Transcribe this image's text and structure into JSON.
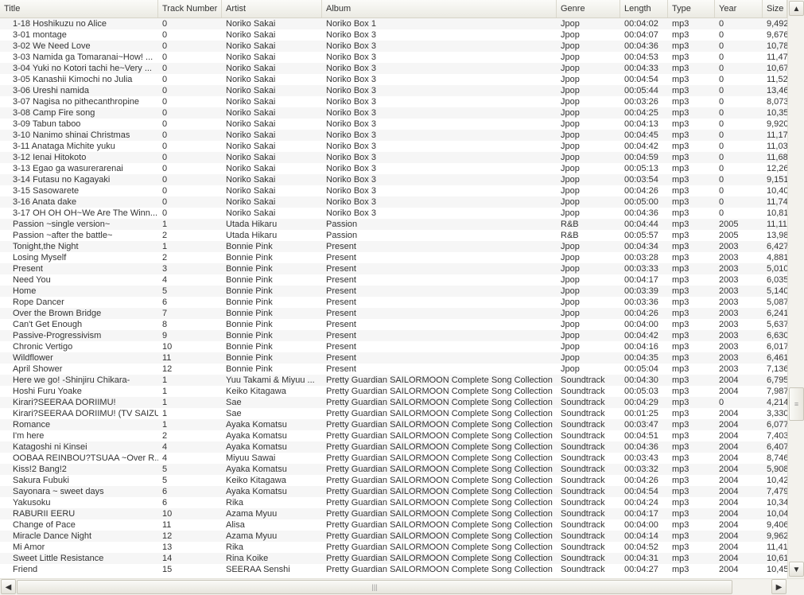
{
  "columns": [
    "Title",
    "Track Number",
    "Artist",
    "Album",
    "Genre",
    "Length",
    "Type",
    "Year",
    "Size"
  ],
  "rows": [
    [
      "1-18 Hoshikuzu no Alice",
      "0",
      "Noriko Sakai",
      "Noriko Box 1",
      "Jpop",
      "00:04:02",
      "mp3",
      "0",
      "9,492"
    ],
    [
      "3-01 montage",
      "0",
      "Noriko Sakai",
      "Noriko Box 3",
      "Jpop",
      "00:04:07",
      "mp3",
      "0",
      "9,676"
    ],
    [
      "3-02 We Need Love",
      "0",
      "Noriko Sakai",
      "Noriko Box 3",
      "Jpop",
      "00:04:36",
      "mp3",
      "0",
      "10,78"
    ],
    [
      "3-03 Namida ga Tomaranai~How! ...",
      "0",
      "Noriko Sakai",
      "Noriko Box 3",
      "Jpop",
      "00:04:53",
      "mp3",
      "0",
      "11,47"
    ],
    [
      "3-04 Yuki no Kotori tachi he~Very ...",
      "0",
      "Noriko Sakai",
      "Noriko Box 3",
      "Jpop",
      "00:04:33",
      "mp3",
      "0",
      "10,67"
    ],
    [
      "3-05 Kanashii Kimochi no Julia",
      "0",
      "Noriko Sakai",
      "Noriko Box 3",
      "Jpop",
      "00:04:54",
      "mp3",
      "0",
      "11,52"
    ],
    [
      "3-06 Ureshi namida",
      "0",
      "Noriko Sakai",
      "Noriko Box 3",
      "Jpop",
      "00:05:44",
      "mp3",
      "0",
      "13,46"
    ],
    [
      "3-07 Nagisa no pithecanthropine",
      "0",
      "Noriko Sakai",
      "Noriko Box 3",
      "Jpop",
      "00:03:26",
      "mp3",
      "0",
      "8,073"
    ],
    [
      "3-08 Camp Fire song",
      "0",
      "Noriko Sakai",
      "Noriko Box 3",
      "Jpop",
      "00:04:25",
      "mp3",
      "0",
      "10,35"
    ],
    [
      "3-09 Tabun taboo",
      "0",
      "Noriko Sakai",
      "Noriko Box 3",
      "Jpop",
      "00:04:13",
      "mp3",
      "0",
      "9,920"
    ],
    [
      "3-10 Nanimo shinai Christmas",
      "0",
      "Noriko Sakai",
      "Noriko Box 3",
      "Jpop",
      "00:04:45",
      "mp3",
      "0",
      "11,17"
    ],
    [
      "3-11 Anataga Michite yuku",
      "0",
      "Noriko Sakai",
      "Noriko Box 3",
      "Jpop",
      "00:04:42",
      "mp3",
      "0",
      "11,03"
    ],
    [
      "3-12 Ienai Hitokoto",
      "0",
      "Noriko Sakai",
      "Noriko Box 3",
      "Jpop",
      "00:04:59",
      "mp3",
      "0",
      "11,68"
    ],
    [
      "3-13 Egao ga wasurerarenai",
      "0",
      "Noriko Sakai",
      "Noriko Box 3",
      "Jpop",
      "00:05:13",
      "mp3",
      "0",
      "12,26"
    ],
    [
      "3-14 Futasu no Kagayaki",
      "0",
      "Noriko Sakai",
      "Noriko Box 3",
      "Jpop",
      "00:03:54",
      "mp3",
      "0",
      "9,151"
    ],
    [
      "3-15 Sasowarete",
      "0",
      "Noriko Sakai",
      "Noriko Box 3",
      "Jpop",
      "00:04:26",
      "mp3",
      "0",
      "10,40"
    ],
    [
      "3-16 Anata dake",
      "0",
      "Noriko Sakai",
      "Noriko Box 3",
      "Jpop",
      "00:05:00",
      "mp3",
      "0",
      "11,74"
    ],
    [
      "3-17 OH OH OH~We Are The Winn...",
      "0",
      "Noriko Sakai",
      "Noriko Box 3",
      "Jpop",
      "00:04:36",
      "mp3",
      "0",
      "10,81"
    ],
    [
      "Passion ~single version~",
      "1",
      "Utada Hikaru",
      "Passion",
      "R&B",
      "00:04:44",
      "mp3",
      "2005",
      "11,11"
    ],
    [
      "Passion ~after the battle~",
      "2",
      "Utada Hikaru",
      "Passion",
      "R&B",
      "00:05:57",
      "mp3",
      "2005",
      "13,98"
    ],
    [
      "Tonight,the Night",
      "1",
      "Bonnie Pink",
      "Present",
      "Jpop",
      "00:04:34",
      "mp3",
      "2003",
      "6,427"
    ],
    [
      "Losing Myself",
      "2",
      "Bonnie Pink",
      "Present",
      "Jpop",
      "00:03:28",
      "mp3",
      "2003",
      "4,881"
    ],
    [
      "Present",
      "3",
      "Bonnie Pink",
      "Present",
      "Jpop",
      "00:03:33",
      "mp3",
      "2003",
      "5,010"
    ],
    [
      "Need You",
      "4",
      "Bonnie Pink",
      "Present",
      "Jpop",
      "00:04:17",
      "mp3",
      "2003",
      "6,035"
    ],
    [
      "Home",
      "5",
      "Bonnie Pink",
      "Present",
      "Jpop",
      "00:03:39",
      "mp3",
      "2003",
      "5,140"
    ],
    [
      "Rope Dancer",
      "6",
      "Bonnie Pink",
      "Present",
      "Jpop",
      "00:03:36",
      "mp3",
      "2003",
      "5,087"
    ],
    [
      "Over the Brown Bridge",
      "7",
      "Bonnie Pink",
      "Present",
      "Jpop",
      "00:04:26",
      "mp3",
      "2003",
      "6,241"
    ],
    [
      "Can't Get Enough",
      "8",
      "Bonnie Pink",
      "Present",
      "Jpop",
      "00:04:00",
      "mp3",
      "2003",
      "5,637"
    ],
    [
      "Passive-Progressivism",
      "9",
      "Bonnie Pink",
      "Present",
      "Jpop",
      "00:04:42",
      "mp3",
      "2003",
      "6,630"
    ],
    [
      "Chronic Vertigo",
      "10",
      "Bonnie Pink",
      "Present",
      "Jpop",
      "00:04:16",
      "mp3",
      "2003",
      "6,017"
    ],
    [
      "Wildflower",
      "11",
      "Bonnie Pink",
      "Present",
      "Jpop",
      "00:04:35",
      "mp3",
      "2003",
      "6,461"
    ],
    [
      "April Shower",
      "12",
      "Bonnie Pink",
      "Present",
      "Jpop",
      "00:05:04",
      "mp3",
      "2003",
      "7,136"
    ],
    [
      "Here we go! -Shinjiru Chikara-",
      "1",
      "Yuu Takami & Miyuu ...",
      "Pretty Guardian SAILORMOON Complete Song Collection",
      "Soundtrack",
      "00:04:30",
      "mp3",
      "2004",
      "6,795"
    ],
    [
      "Hoshi Furu Yoake",
      "1",
      "Keiko Kitagawa",
      "Pretty Guardian SAILORMOON Complete Song Collection",
      "Soundtrack",
      "00:05:03",
      "mp3",
      "2004",
      "7,987"
    ],
    [
      "Kirari?SEERAA DORIIMU!",
      "1",
      "Sae",
      "Pretty Guardian SAILORMOON Complete Song Collection",
      "Soundtrack",
      "00:04:29",
      "mp3",
      "0",
      "4,214"
    ],
    [
      "Kirari?SEERAA DORIIMU! (TV SAIZU)",
      "1",
      "Sae",
      "Pretty Guardian SAILORMOON Complete Song Collection",
      "Soundtrack",
      "00:01:25",
      "mp3",
      "2004",
      "3,330"
    ],
    [
      "Romance",
      "1",
      "Ayaka Komatsu",
      "Pretty Guardian SAILORMOON Complete Song Collection",
      "Soundtrack",
      "00:03:47",
      "mp3",
      "2004",
      "6,077"
    ],
    [
      "I'm here",
      "2",
      "Ayaka Komatsu",
      "Pretty Guardian SAILORMOON Complete Song Collection",
      "Soundtrack",
      "00:04:51",
      "mp3",
      "2004",
      "7,403"
    ],
    [
      "Katagoshi ni Kinsei",
      "4",
      "Ayaka Komatsu",
      "Pretty Guardian SAILORMOON Complete Song Collection",
      "Soundtrack",
      "00:04:36",
      "mp3",
      "2004",
      "6,407"
    ],
    [
      "OOBAA REINBOU?TSUAA ~Over R...",
      "4",
      "Miyuu Sawai",
      "Pretty Guardian SAILORMOON Complete Song Collection",
      "Soundtrack",
      "00:03:43",
      "mp3",
      "2004",
      "8,746"
    ],
    [
      "Kiss!2 Bang!2",
      "5",
      "Ayaka Komatsu",
      "Pretty Guardian SAILORMOON Complete Song Collection",
      "Soundtrack",
      "00:03:32",
      "mp3",
      "2004",
      "5,908"
    ],
    [
      "Sakura Fubuki",
      "5",
      "Keiko Kitagawa",
      "Pretty Guardian SAILORMOON Complete Song Collection",
      "Soundtrack",
      "00:04:26",
      "mp3",
      "2004",
      "10,42"
    ],
    [
      "Sayonara ~ sweet days",
      "6",
      "Ayaka Komatsu",
      "Pretty Guardian SAILORMOON Complete Song Collection",
      "Soundtrack",
      "00:04:54",
      "mp3",
      "2004",
      "7,479"
    ],
    [
      "Yakusoku",
      "6",
      "Rika",
      "Pretty Guardian SAILORMOON Complete Song Collection",
      "Soundtrack",
      "00:04:24",
      "mp3",
      "2004",
      "10,34"
    ],
    [
      "RABURII EERU",
      "10",
      "Azama Myuu",
      "Pretty Guardian SAILORMOON Complete Song Collection",
      "Soundtrack",
      "00:04:17",
      "mp3",
      "2004",
      "10,04"
    ],
    [
      "Change of Pace",
      "11",
      "Alisa",
      "Pretty Guardian SAILORMOON Complete Song Collection",
      "Soundtrack",
      "00:04:00",
      "mp3",
      "2004",
      "9,406"
    ],
    [
      "Miracle Dance Night",
      "12",
      "Azama Myuu",
      "Pretty Guardian SAILORMOON Complete Song Collection",
      "Soundtrack",
      "00:04:14",
      "mp3",
      "2004",
      "9,962"
    ],
    [
      "Mi Amor",
      "13",
      "Rika",
      "Pretty Guardian SAILORMOON Complete Song Collection",
      "Soundtrack",
      "00:04:52",
      "mp3",
      "2004",
      "11,41"
    ],
    [
      "Sweet Little Resistance",
      "14",
      "Rina Koike",
      "Pretty Guardian SAILORMOON Complete Song Collection",
      "Soundtrack",
      "00:04:31",
      "mp3",
      "2004",
      "10,61"
    ],
    [
      "Friend",
      "15",
      "SEERAA Senshi",
      "Pretty Guardian SAILORMOON Complete Song Collection",
      "Soundtrack",
      "00:04:27",
      "mp3",
      "2004",
      "10,45"
    ]
  ],
  "scroll_position": 0.7
}
